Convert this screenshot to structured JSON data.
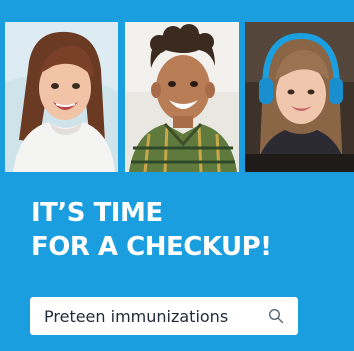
{
  "headline": {
    "line1": "IT’S TIME",
    "line2": "FOR A CHECKUP!"
  },
  "search": {
    "value": "Preteen immunizations",
    "icon": "search-icon"
  },
  "colors": {
    "background": "#1a9ee0",
    "text": "#ffffff",
    "search_bg": "#ffffff",
    "search_text": "#1f2a37"
  }
}
